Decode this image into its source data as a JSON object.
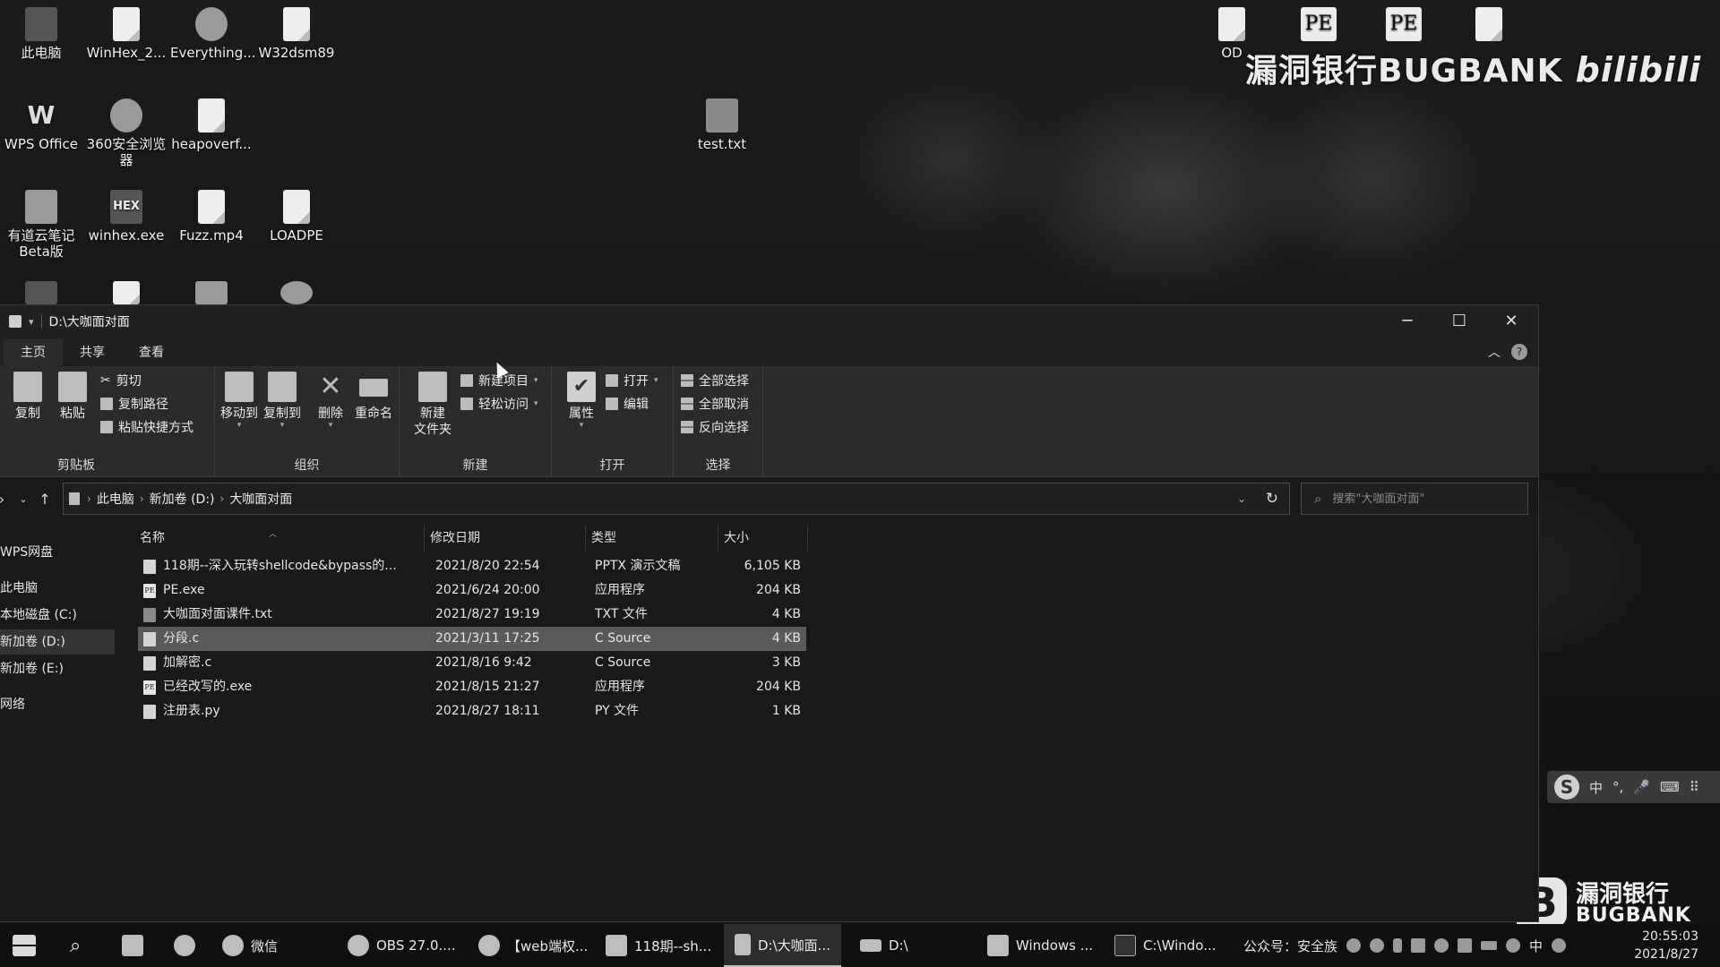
{
  "desktop": {
    "icons": [
      {
        "label": "此电脑",
        "glyph": ""
      },
      {
        "label": "WinHex_2...",
        "glyph": ""
      },
      {
        "label": "Everything...",
        "glyph": ""
      },
      {
        "label": "W32dsm89",
        "glyph": ""
      },
      {
        "label": "OD",
        "glyph": ""
      },
      {
        "label": "",
        "glyph": "PE"
      },
      {
        "label": "",
        "glyph": "PE"
      },
      {
        "label": "WPS Office",
        "glyph": "W"
      },
      {
        "label": "360安全浏览器",
        "glyph": ""
      },
      {
        "label": "heapoverf...",
        "glyph": ""
      },
      {
        "label": "test.txt",
        "glyph": ""
      },
      {
        "label": "有道云笔记Beta版",
        "glyph": ""
      },
      {
        "label": "winhex.exe",
        "glyph": "HEX"
      },
      {
        "label": "Fuzz.mp4",
        "glyph": ""
      },
      {
        "label": "LOADPE",
        "glyph": ""
      }
    ],
    "watermark": "漏洞银行BUGBANK",
    "bili_mark": "bilibili",
    "brand_cn": "漏洞银行",
    "brand_en": "BUGBANK",
    "brand_mark": "B",
    "ime_bar": [
      "S",
      "中",
      "°,",
      "🎤",
      "⌨",
      "⠿"
    ]
  },
  "explorer": {
    "title": "D:\\大咖面对面",
    "tabs": [
      "主页",
      "共享",
      "查看"
    ],
    "ribbon": {
      "clipboard": {
        "copy": "复制",
        "paste": "粘贴",
        "cut": "剪切",
        "copy_path": "复制路径",
        "paste_shortcut": "粘贴快捷方式",
        "label": "剪贴板"
      },
      "organize": {
        "move_to": "移动到",
        "copy_to": "复制到",
        "delete": "删除",
        "rename": "重命名",
        "label": "组织"
      },
      "new": {
        "new_folder_line1": "新建",
        "new_folder_line2": "文件夹",
        "new_item": "新建项目",
        "easy_access": "轻松访问",
        "label": "新建"
      },
      "open": {
        "properties": "属性",
        "open": "打开",
        "edit": "编辑",
        "label": "打开"
      },
      "select": {
        "select_all": "全部选择",
        "select_none": "全部取消",
        "invert": "反向选择",
        "label": "选择"
      }
    },
    "address": {
      "crumbs": [
        "此电脑",
        "新加卷 (D:)",
        "大咖面对面"
      ]
    },
    "search": {
      "placeholder": "搜索\"大咖面对面\""
    },
    "nav": [
      {
        "label": "WPS网盘"
      },
      {
        "label": "此电脑"
      },
      {
        "label": "本地磁盘 (C:)"
      },
      {
        "label": "新加卷 (D:)"
      },
      {
        "label": "新加卷 (E:)"
      },
      {
        "label": "网络"
      }
    ],
    "columns": {
      "name": "名称",
      "modified": "修改日期",
      "type": "类型",
      "size": "大小"
    },
    "files": [
      {
        "name": "118期--深入玩转shellcode&bypass的...",
        "date": "2021/8/20 22:54",
        "type": "PPTX 演示文稿",
        "size": "6,105 KB",
        "icon": ""
      },
      {
        "name": "PE.exe",
        "date": "2021/6/24 20:00",
        "type": "应用程序",
        "size": "204 KB",
        "icon": "PE"
      },
      {
        "name": "大咖面对面课件.txt",
        "date": "2021/8/27 19:19",
        "type": "TXT 文件",
        "size": "4 KB",
        "icon": ""
      },
      {
        "name": "分段.c",
        "date": "2021/3/11 17:25",
        "type": "C Source",
        "size": "4 KB",
        "icon": ""
      },
      {
        "name": "加解密.c",
        "date": "2021/8/16 9:42",
        "type": "C Source",
        "size": "3 KB",
        "icon": ""
      },
      {
        "name": "已经改写的.exe",
        "date": "2021/8/15 21:27",
        "type": "应用程序",
        "size": "204 KB",
        "icon": "PE"
      },
      {
        "name": "注册表.py",
        "date": "2021/8/27 18:11",
        "type": "PY 文件",
        "size": "1 KB",
        "icon": ""
      }
    ],
    "selected_file": "分段.c",
    "selected_nav": "新加卷 (D:)"
  },
  "taskbar": {
    "items": [
      {
        "label": "微信"
      },
      {
        "label": "OBS 27.0...."
      },
      {
        "label": "【web端权..."
      },
      {
        "label": "118期--sh..."
      },
      {
        "label": "D:\\大咖面..."
      },
      {
        "label": "D:\\"
      },
      {
        "label": "Windows ..."
      },
      {
        "label": "C:\\Windo..."
      }
    ],
    "active_item": "D:\\大咖面...",
    "tray_text": "公众号：安全族",
    "ime": "中",
    "time": "20:55:03",
    "date": "2021/8/27"
  }
}
